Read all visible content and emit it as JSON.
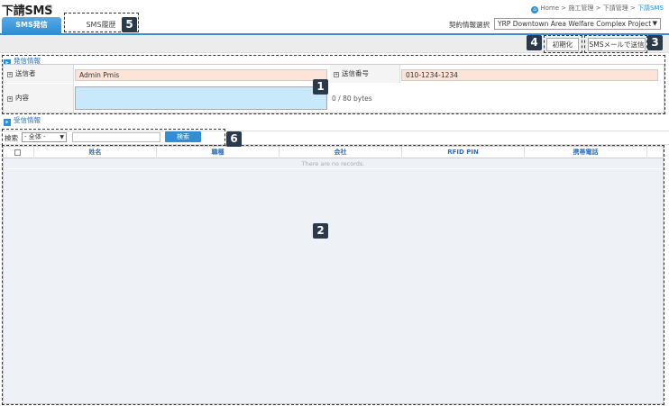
{
  "header": {
    "title": "下請SMS",
    "title_link_icon": "external-link-icon",
    "breadcrumb": [
      "Home",
      "施工管理",
      "下請管理",
      "下請SMS"
    ],
    "breadcrumb_sep": ">"
  },
  "tabs": [
    {
      "label": "SMS発信",
      "active": true
    },
    {
      "label": "SMS履歴",
      "active": false
    }
  ],
  "contract": {
    "label": "契約情報選択",
    "selected": "YRP Downtown Area Welfare Complex Project"
  },
  "toolbar": {
    "reset_label": "初期化",
    "send_label": "SMSメールで送信"
  },
  "sender_section": {
    "heading": "発信情報",
    "sender_label": "送信者",
    "sender_value": "Admin Pmis",
    "number_label": "送信番号",
    "number_value": "010-1234-1234",
    "content_label": "内容",
    "content_value": "",
    "byte_counter": "0 / 80 bytes"
  },
  "receiver_section": {
    "heading": "受信情報"
  },
  "search": {
    "label": "検索",
    "select_value": "- 全体 -",
    "input_value": "",
    "button_label": "検索"
  },
  "grid": {
    "columns": [
      "姓名",
      "職種",
      "会社",
      "RFID PIN",
      "携帯電話"
    ],
    "empty_text": "There are no records."
  },
  "badges": [
    "1",
    "2",
    "3",
    "4",
    "5",
    "6"
  ],
  "colors": {
    "accent": "#2e8fd6",
    "input_fill": "#fde4d7",
    "textarea_fill": "#c7e9f9",
    "badge": "#2b3a4a"
  }
}
